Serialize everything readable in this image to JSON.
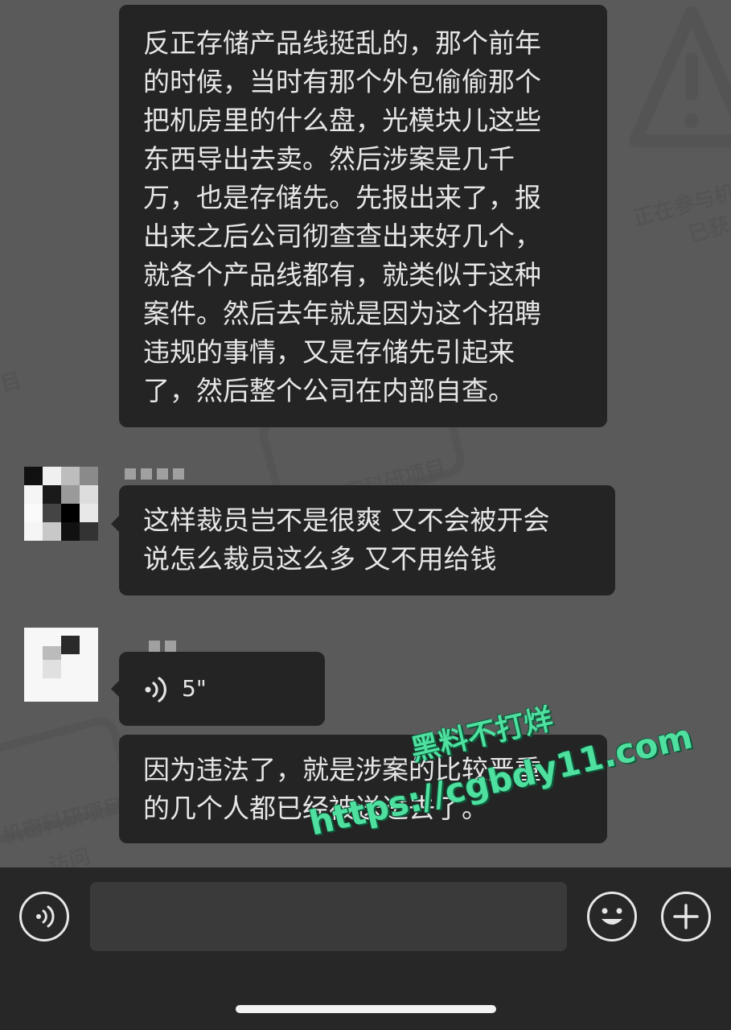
{
  "messages": [
    {
      "type": "text",
      "lines": [
        "反正存储产品线挺乱的，那个前年",
        "的时候，当时有那个外包偷偷那个",
        "把机房里的什么盘，光模块儿这些",
        "东西导出去卖。然后涉案是几千",
        "万，也是存储先。先报出来了，报",
        "出来之后公司彻查查出来好几个，",
        "就各个产品线都有，就类似于这种",
        "案件。然后去年就是因为这个招聘",
        "违规的事情，又是存储先引起来",
        "了，然后整个公司在内部自查。"
      ]
    },
    {
      "type": "text",
      "lines": [
        "这样裁员岂不是很爽 又不会被开会",
        "说怎么裁员这么多 又不用给钱"
      ]
    },
    {
      "type": "voice",
      "duration": "5\""
    },
    {
      "type": "text",
      "lines": [
        "因为违法了，就是涉案的比较严重",
        "的几个人都已经被送进去了。"
      ]
    }
  ],
  "watermark": {
    "line1": "黑料不打烊",
    "line2": "https://cgbdy11.com",
    "color": "#4fe0a0"
  },
  "background_watermark": {
    "texts": [
      "正在参与机",
      "已获",
      "机密科研项目",
      "机密科研项目",
      "访问",
      "目"
    ]
  },
  "input_bar": {
    "voice_icon": "voice-wave-icon",
    "emoji_icon": "smiley-icon",
    "add_icon": "plus-icon"
  },
  "colors": {
    "bubble": "#242424",
    "text": "#e6e6e6",
    "background": "#5a5a5a",
    "input_bar": "#272727"
  }
}
